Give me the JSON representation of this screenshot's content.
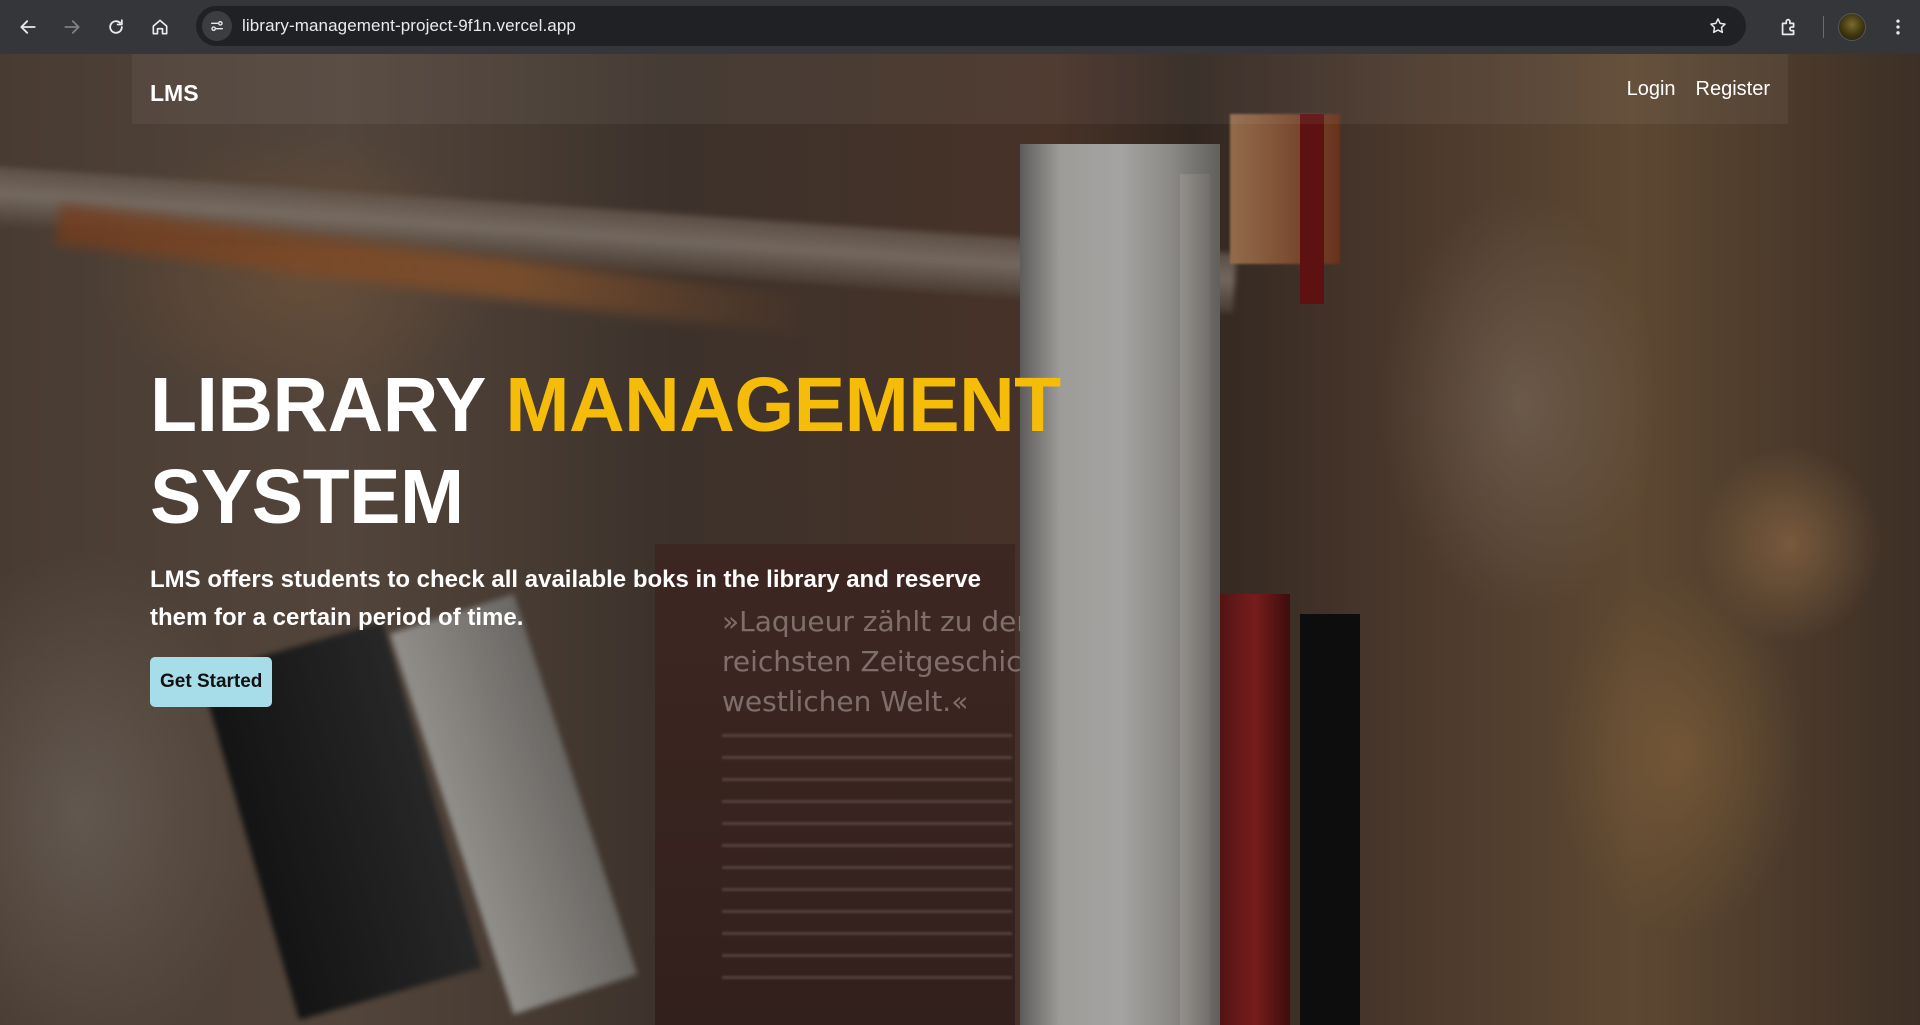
{
  "browser": {
    "url": "library-management-project-9f1n.vercel.app",
    "icons": [
      "back-icon",
      "forward-icon",
      "reload-icon",
      "home-icon",
      "site-info-icon",
      "bookmark-star-icon",
      "extensions-icon",
      "profile-avatar",
      "more-menu-icon"
    ]
  },
  "navbar": {
    "brand": "LMS",
    "links": [
      "Login",
      "Register"
    ]
  },
  "hero": {
    "title_part1": "LIBRARY ",
    "title_accent": "MANAGEMENT",
    "title_part2": "SYSTEM",
    "subtitle": "LMS offers students to check all available boks in the library and reserve them for a certain period of time.",
    "cta_label": "Get Started"
  },
  "background_book": {
    "line1": "»Laqueur zählt zu den",
    "line2": "reichsten Zeitgeschic",
    "line3": "westlichen Welt.«"
  },
  "colors": {
    "accent": "#f5bc0a",
    "cta_background": "#a7dde9",
    "chrome_bar": "#35363a",
    "omnibox": "#202124"
  }
}
